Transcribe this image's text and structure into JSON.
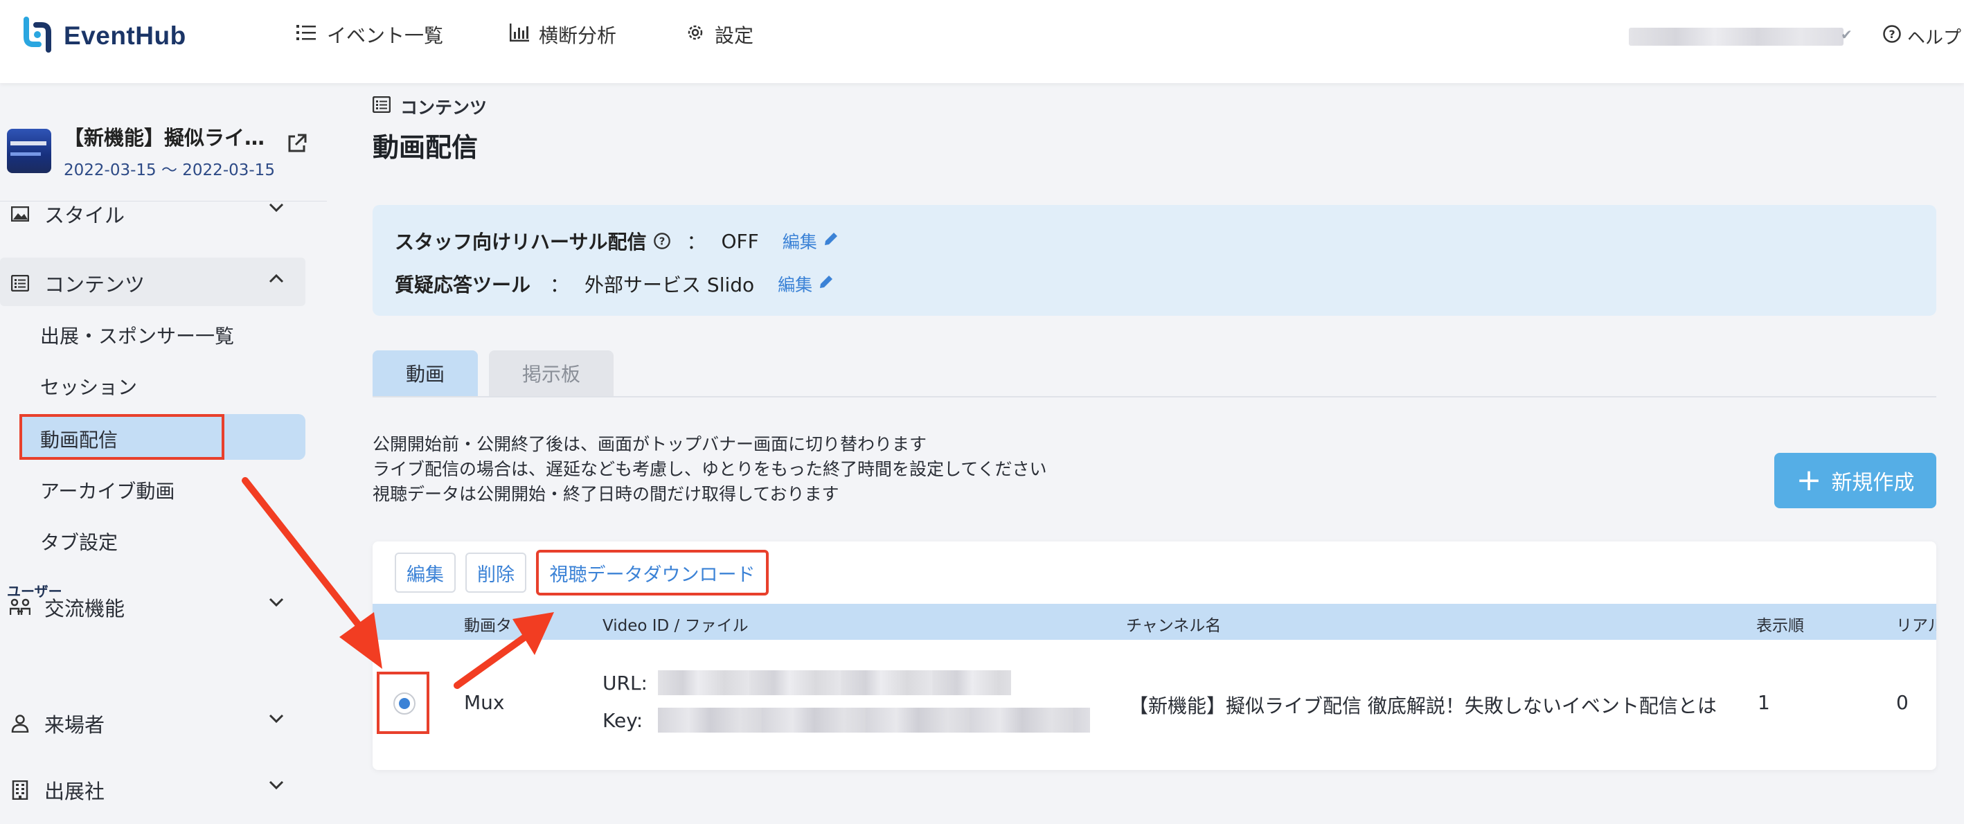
{
  "app": {
    "brand": "EventHub",
    "brand_color": "#1b3567",
    "accent": "#3b82d6",
    "highlight": "#e8402c"
  },
  "topnav": {
    "events_label": "イベント一覧",
    "analytics_label": "横断分析",
    "settings_label": "設定",
    "help_label": "ヘルプ"
  },
  "event": {
    "title": "【新機能】擬似ライ…",
    "dates": "2022-03-15 〜 2022-03-15"
  },
  "sidebar": {
    "style_label": "スタイル",
    "contents_label": "コンテンツ",
    "sub_items": [
      "出展・スポンサー一覧",
      "セッション",
      "動画配信",
      "アーカイブ動画",
      "タブ設定"
    ],
    "exchange_label": "交流機能",
    "user_section": "ユーザー",
    "visitors_label": "来場者",
    "exhibitors_label": "出展社"
  },
  "breadcrumb": "コンテンツ",
  "page_title": "動画配信",
  "info": {
    "rehearsal_label": "スタッフ向けリハーサル配信",
    "rehearsal_value": "OFF",
    "qa_label": "質疑応答ツール",
    "qa_value": "外部サービス Slido",
    "colon": "：",
    "edit_label": "編集"
  },
  "tabs": [
    "動画",
    "掲示板"
  ],
  "notes": [
    "公開開始前・公開終了後は、画面がトップバナー画面に切り替わります",
    "ライブ配信の場合は、遅延なども考慮し、ゆとりをもった終了時間を設定してください",
    "視聴データは公開開始・終了日時の間だけ取得しております"
  ],
  "new_button": "新規作成",
  "toolbar": {
    "edit": "編集",
    "delete": "削除",
    "download": "視聴データダウンロード"
  },
  "table": {
    "headers": [
      "動画タ",
      "Video ID / ファイル",
      "チャンネル名",
      "表示順",
      "リアル"
    ],
    "row": {
      "type": "Mux",
      "url_label": "URL:",
      "key_label": "Key:",
      "channel": "【新機能】擬似ライブ配信 徹底解説！失敗しないイベント配信とは",
      "order": "1",
      "realtime": "0"
    }
  }
}
